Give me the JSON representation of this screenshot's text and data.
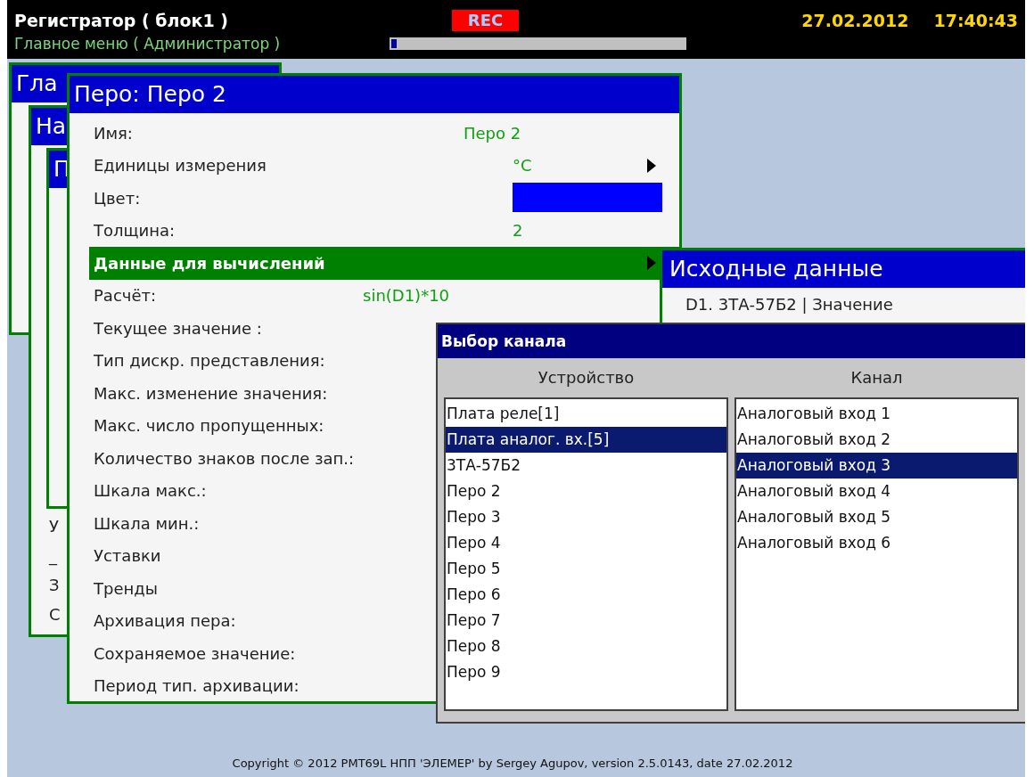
{
  "header": {
    "title": "Регистратор ( блок1 )",
    "subtitle": "Главное меню ( Администратор )",
    "rec": "REC",
    "progress": {
      "level": 0.03
    },
    "date": "27.02.2012",
    "time": "17:40:43"
  },
  "background_windows": [
    {
      "title": "Гла"
    },
    {
      "title": "На",
      "items": [
        "У",
        "_",
        "З",
        "С"
      ]
    },
    {
      "title": "П"
    }
  ],
  "pen_window": {
    "title": "Перо: Перо 2",
    "rows": [
      {
        "label": "Имя:",
        "kind": "value",
        "value": "Перо 2",
        "selected": false
      },
      {
        "label": "Единицы измерения",
        "kind": "submenu",
        "value": "°С",
        "selected": false
      },
      {
        "label": "Цвет:",
        "kind": "color",
        "color": "#0000ff",
        "selected": false
      },
      {
        "label": "Толщина:",
        "kind": "value",
        "value": "2",
        "selected": false
      },
      {
        "label": "Данные для вычислений",
        "kind": "submenu",
        "selected": true
      },
      {
        "label": "Расчёт:",
        "kind": "value",
        "value": "sin(D1)*10",
        "selected": false
      },
      {
        "label": "Текущее значение :",
        "kind": "plain",
        "selected": false
      },
      {
        "label": "Тип дискр. представления:",
        "kind": "plain",
        "selected": false
      },
      {
        "label": "Макс. изменение значения:",
        "kind": "plain",
        "selected": false
      },
      {
        "label": "Макс. число пропущенных:",
        "kind": "plain",
        "selected": false
      },
      {
        "label": "Количество знаков после зап.:",
        "kind": "plain",
        "selected": false
      },
      {
        "label": "Шкала макс.:",
        "kind": "plain",
        "selected": false
      },
      {
        "label": "Шкала мин.:",
        "kind": "plain",
        "selected": false
      },
      {
        "label": "Уставки",
        "kind": "plain",
        "selected": false
      },
      {
        "label": "Тренды",
        "kind": "plain",
        "selected": false
      },
      {
        "label": "Архивация пера:",
        "kind": "plain",
        "selected": false
      },
      {
        "label": "Сохраняемое значение:",
        "kind": "plain",
        "selected": false
      },
      {
        "label": "Период тип. архивации:",
        "kind": "plain",
        "selected": false
      }
    ]
  },
  "source_window": {
    "title": "Исходные данные",
    "rows": [
      "D1. 3ТА-57Б2 | Значение"
    ]
  },
  "channel_dialog": {
    "title": "Выбор канала",
    "columns": [
      {
        "heading": "Устройство",
        "items": [
          {
            "label": "Плата реле[1]",
            "selected": false
          },
          {
            "label": "Плата аналог. вх.[5]",
            "selected": true
          },
          {
            "label": "3ТА-57Б2",
            "selected": false
          },
          {
            "label": "Перо 2",
            "selected": false
          },
          {
            "label": "Перо 3",
            "selected": false
          },
          {
            "label": "Перо 4",
            "selected": false
          },
          {
            "label": "Перо 5",
            "selected": false
          },
          {
            "label": "Перо 6",
            "selected": false
          },
          {
            "label": "Перо 7",
            "selected": false
          },
          {
            "label": "Перо 8",
            "selected": false
          },
          {
            "label": "Перо 9",
            "selected": false
          }
        ]
      },
      {
        "heading": "Канал",
        "items": [
          {
            "label": "Аналоговый вход 1",
            "selected": false
          },
          {
            "label": "Аналоговый вход 2",
            "selected": false
          },
          {
            "label": "Аналоговый вход 3",
            "selected": true
          },
          {
            "label": "Аналоговый вход 4",
            "selected": false
          },
          {
            "label": "Аналоговый вход 5",
            "selected": false
          },
          {
            "label": "Аналоговый вход 6",
            "selected": false
          }
        ]
      }
    ]
  },
  "footer": "Copyright © 2012 PMT69L НПП 'ЭЛЕМЕР' by Sergey Agupov, version 2.5.0143, date 27.02.2012"
}
